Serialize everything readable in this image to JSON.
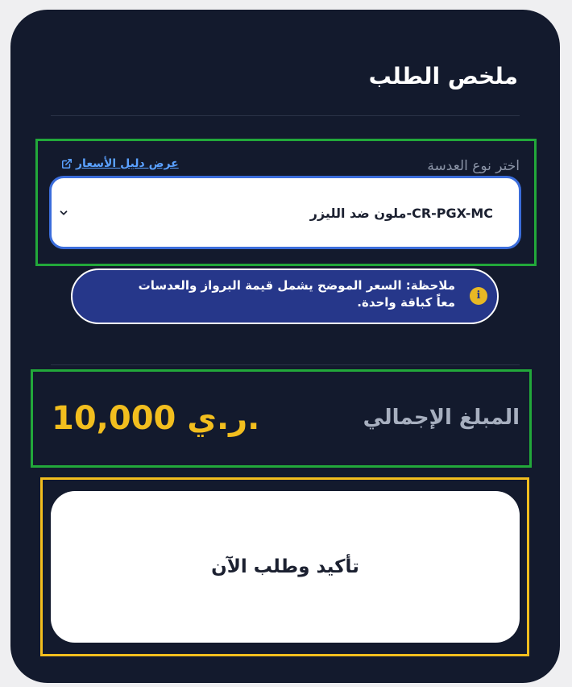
{
  "order_summary": {
    "title": "ملخص الطلب",
    "lens_type_label": "اختر نوع العدسة",
    "price_guide_link": "عرض دليل الأسعار",
    "selected_lens": "CR-PGX-MC-ملون ضد الليزر",
    "note": "ملاحظة: السعر الموضح يشمل قيمة البرواز والعدسات معاً كباقة واحدة.",
    "total_label": "المبلغ الإجمالي",
    "total_amount": "10,000 ر.ي.",
    "confirm_button": "تأكيد وطلب الآن"
  },
  "colors": {
    "card_background": "#131a2d",
    "accent_yellow": "#f2be1e",
    "select_border": "#3b6ddb",
    "note_background": "#26378a",
    "link_blue": "#5aa0ff"
  },
  "icons": {
    "link": "external-link-icon",
    "dropdown": "chevron-down-icon",
    "note": "info-icon"
  }
}
